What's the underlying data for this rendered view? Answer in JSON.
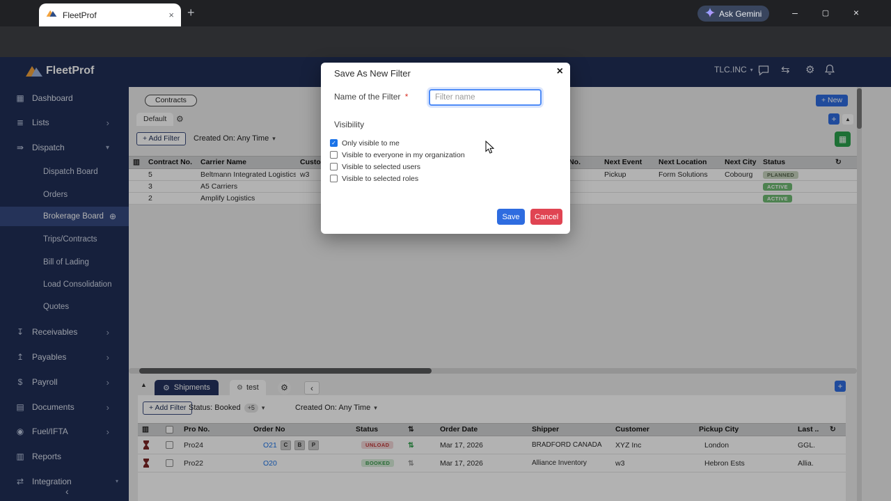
{
  "browser": {
    "tab_title": "FleetProf",
    "url": "fleetprof.com/tms/partner/manage-contract-board",
    "gemini_label": "Ask Gemini"
  },
  "app_header": {
    "brand": "FleetProf",
    "org": "TLC.INC"
  },
  "sidebar": {
    "items": [
      "Dashboard",
      "Lists",
      "Dispatch",
      "Receivables",
      "Payables",
      "Payroll",
      "Documents",
      "Fuel/IFTA",
      "Reports",
      "Integration"
    ],
    "item_icons": [
      "▦",
      "≣",
      "⇛",
      "↧",
      "↥",
      "$",
      "▤",
      "◉",
      "▥",
      "⇄"
    ],
    "dispatch_children": [
      "Dispatch Board",
      "Orders",
      "Brokerage Board",
      "Trips/Contracts",
      "Bill of Lading",
      "Load Consolidation",
      "Quotes"
    ]
  },
  "contracts": {
    "panel_tab": "Contracts",
    "view_tab": "Default",
    "add_filter": "+ Add Filter",
    "created_on": "Created On: Any Time",
    "new_button": "+ New",
    "columns": {
      "contract_no": "Contract No.",
      "carrier": "Carrier Name",
      "customer": "Customer",
      "no": "No.",
      "next_event": "Next Event",
      "next_location": "Next Location",
      "next_city": "Next City",
      "status": "Status"
    },
    "rows": [
      {
        "contract_no": "5",
        "carrier": "Beltmann Integrated Logistics",
        "customer": "w3",
        "next_event": "Pickup",
        "next_location": "Form Solutions",
        "next_city": "Cobourg",
        "status": "PLANNED"
      },
      {
        "contract_no": "3",
        "carrier": "A5 Carriers",
        "customer": "",
        "next_event": "",
        "next_location": "",
        "next_city": "",
        "status": "ACTIVE"
      },
      {
        "contract_no": "2",
        "carrier": "Amplify Logistics",
        "customer": "",
        "next_event": "",
        "next_location": "",
        "next_city": "",
        "status": "ACTIVE"
      }
    ]
  },
  "shipments": {
    "tab_shipments": "Shipments",
    "tab_test": "test",
    "add_filter": "+ Add Filter",
    "status_filter": "Status: Booked",
    "status_extra": "+5",
    "created_on": "Created On: Any Time",
    "columns": {
      "pro_no": "Pro No.",
      "order_no": "Order No",
      "status": "Status",
      "order_date": "Order Date",
      "shipper": "Shipper",
      "customer": "Customer",
      "pickup_city": "Pickup City",
      "last": "Last .."
    },
    "rows": [
      {
        "pro_no": "Pro24",
        "order_no": "O21",
        "badges": [
          "C",
          "B",
          "P"
        ],
        "status": "UNLOAD",
        "order_date": "Mar 17, 2026",
        "shipper": "BRADFORD CANADA",
        "customer": "XYZ Inc",
        "pickup_city": "London",
        "last": "GGL."
      },
      {
        "pro_no": "Pro22",
        "order_no": "O20",
        "badges": [],
        "status": "BOOKED",
        "order_date": "Mar 17, 2026",
        "shipper": "Alliance Inventory",
        "customer": "w3",
        "pickup_city": "Hebron Ests",
        "last": "Allia."
      }
    ]
  },
  "modal": {
    "title": "Save As New Filter",
    "name_label": "Name of the Filter",
    "required_mark": "*",
    "input_placeholder": "Filter name",
    "visibility_label": "Visibility",
    "options": [
      {
        "label": "Only visible to me",
        "checked": true
      },
      {
        "label": "Visible to everyone in my organization",
        "checked": false
      },
      {
        "label": "Visible to selected users",
        "checked": false
      },
      {
        "label": "Visible to selected roles",
        "checked": false
      }
    ],
    "save": "Save",
    "cancel": "Cancel"
  },
  "icons": {
    "close": "×",
    "plus": "+",
    "caret_down": "▾",
    "caret_up": "▲",
    "chevron_right": "›",
    "chevron_left": "‹",
    "menu_dots": "⋮",
    "refresh": "↻",
    "sort": "⇅",
    "star": "☆",
    "gear": "⚙",
    "back": "←",
    "forward": "→",
    "minimize": "–",
    "maximize": "▢",
    "check": "✓",
    "plus_circle": "⊕",
    "swap": "⇆",
    "grid": "▦",
    "columns": "▥"
  },
  "colors": {
    "accent_blue": "#2e6ce0",
    "navy": "#202e56",
    "green_button": "#2aa14c",
    "cancel_red": "#e04452",
    "link_blue": "#1a73e8",
    "active_badge_bg": "#6fbb73",
    "planned_badge_bg": "#c9d6c0",
    "unload_badge_bg": "#f3d7d9",
    "booked_badge_bg": "#d7ecd9"
  }
}
